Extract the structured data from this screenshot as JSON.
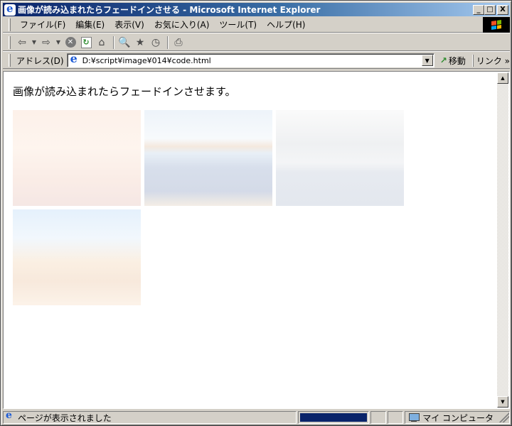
{
  "window": {
    "title": "画像が読み込まれたらフェードインさせる - Microsoft Internet Explorer",
    "minimize": "_",
    "maximize": "□",
    "close": "X"
  },
  "menu": [
    "ファイル(F)",
    "編集(E)",
    "表示(V)",
    "お気に入り(A)",
    "ツール(T)",
    "ヘルプ(H)"
  ],
  "toolbar": {
    "back": "⇦",
    "forward": "⇨",
    "dropdown": "▼",
    "stop": "✕",
    "refresh": "↻",
    "home": "⌂",
    "search": "🔍",
    "favorites": "★",
    "history": "◷",
    "print": "⎙"
  },
  "address": {
    "label": "アドレス(D)",
    "value": "D:¥script¥image¥014¥code.html",
    "dropdown": "▼",
    "go_icon": "↗",
    "go_label": "移動",
    "links": "リンク »"
  },
  "page": {
    "heading": "画像が読み込まれたらフェードインさせます。",
    "images": [
      {
        "name": "sunset-scenery",
        "opacity": 0.18
      },
      {
        "name": "coast-scenery",
        "opacity": 0.2
      },
      {
        "name": "mountain-lake-scenery",
        "opacity": 0.16
      },
      {
        "name": "desert-peak-scenery",
        "opacity": 0.2
      }
    ]
  },
  "scrollbar": {
    "up": "▲",
    "down": "▼"
  },
  "status": {
    "message": "ページが表示されました",
    "progress": 1.0,
    "zone": "マイ コンピュータ"
  },
  "colors": {
    "titlebar_start": "#0a246a",
    "titlebar_end": "#a6caf0",
    "chrome": "#d4d0c8",
    "progress": "#0a246a"
  }
}
